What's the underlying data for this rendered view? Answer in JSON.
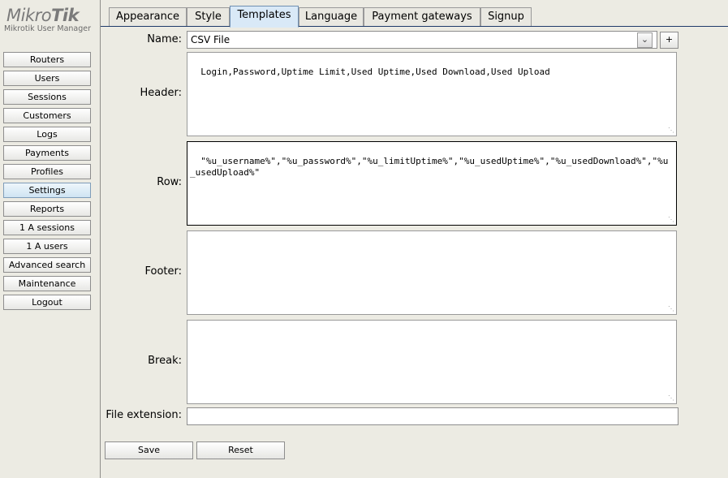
{
  "app": {
    "logo_regular": "Mikro",
    "logo_bold": "Tik",
    "subtitle": "Mikrotik User Manager"
  },
  "sidebar": {
    "items": [
      {
        "label": "Routers"
      },
      {
        "label": "Users"
      },
      {
        "label": "Sessions"
      },
      {
        "label": "Customers"
      },
      {
        "label": "Logs"
      },
      {
        "label": "Payments"
      },
      {
        "label": "Profiles"
      },
      {
        "label": "Settings",
        "active": true
      },
      {
        "label": "Reports"
      },
      {
        "label": "1 A sessions"
      },
      {
        "label": "1 A users"
      },
      {
        "label": "Advanced search"
      },
      {
        "label": "Maintenance"
      },
      {
        "label": "Logout"
      }
    ]
  },
  "tabs": [
    {
      "label": "Appearance"
    },
    {
      "label": "Style"
    },
    {
      "label": "Templates",
      "active": true
    },
    {
      "label": "Language"
    },
    {
      "label": "Payment gateways"
    },
    {
      "label": "Signup"
    }
  ],
  "form": {
    "name_label": "Name:",
    "name_value": "CSV File",
    "add_label": "+",
    "header_label": "Header:",
    "header_value": "Login,Password,Uptime Limit,Used Uptime,Used Download,Used Upload",
    "row_label": "Row:",
    "row_value": "\"%u_username%\",\"%u_password%\",\"%u_limitUptime%\",\"%u_usedUptime%\",\"%u_usedDownload%\",\"%u_usedUpload%\"",
    "footer_label": "Footer:",
    "footer_value": "",
    "break_label": "Break:",
    "break_value": "",
    "extension_label": "File extension:",
    "extension_value": "",
    "save_label": "Save",
    "reset_label": "Reset"
  },
  "colors": {
    "background": "#ecebe3",
    "active_tab": "#d9e9f7",
    "tab_underline": "#1f3b6b"
  }
}
